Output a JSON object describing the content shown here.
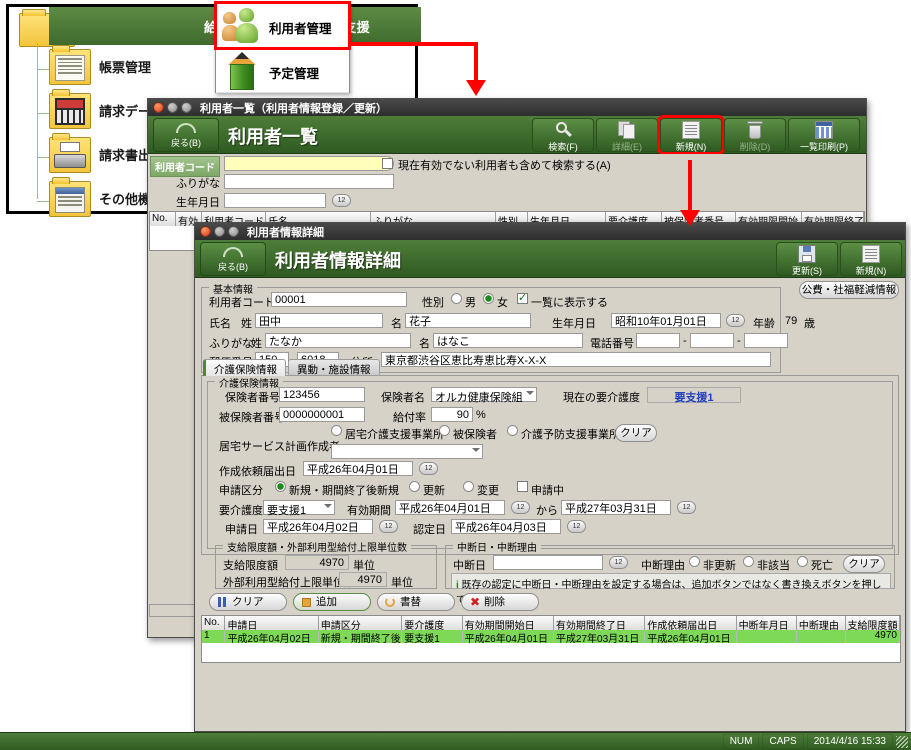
{
  "base_window": {
    "header_title": "給付管理/介護報酬請求支援",
    "tree_items": [
      {
        "label": "帳票管理",
        "icon": "document-folder-icon"
      },
      {
        "label": "請求データ作成",
        "icon": "calculator-folder-icon"
      },
      {
        "label": "請求書出力",
        "icon": "printer-folder-icon"
      },
      {
        "label": "その他機能",
        "icon": "list-folder-icon"
      }
    ]
  },
  "popup_menu": {
    "items": [
      {
        "label": "利用者管理",
        "icon": "people-icon",
        "highlighted": true
      },
      {
        "label": "予定管理",
        "icon": "pencil-icon",
        "highlighted": false
      }
    ]
  },
  "list_window": {
    "title": "利用者一覧（利用者情報登録／更新）",
    "bar_title": "利用者一覧",
    "back_label": "戻る(B)",
    "toolbar": [
      {
        "label": "検索(F)",
        "icon": "search-icon",
        "enabled": true,
        "highlighted": false
      },
      {
        "label": "詳細(E)",
        "icon": "documents-icon",
        "enabled": false,
        "highlighted": false
      },
      {
        "label": "新規(N)",
        "icon": "document-icon",
        "enabled": true,
        "highlighted": true
      },
      {
        "label": "削除(D)",
        "icon": "trash-icon",
        "enabled": false,
        "highlighted": false
      },
      {
        "label": "一覧印刷(P)",
        "icon": "grid-icon",
        "enabled": true,
        "highlighted": false
      }
    ],
    "search": {
      "code_label": "利用者コード",
      "code_value": "",
      "kana_label": "ふりがな",
      "kana_value": "",
      "birth_label": "生年月日",
      "birth_value": "",
      "calendar_icon": "12",
      "checkbox_label": "現在有効でない利用者も含めて検索する(A)",
      "checkbox_checked": false
    },
    "columns": [
      "No.",
      "有効",
      "利用者コード",
      "氏名",
      "ふりがな",
      "性別",
      "生年月日",
      "要介護度",
      "被保険者番号",
      "有効期限開始",
      "有効期限終了"
    ]
  },
  "detail_window": {
    "title": "利用者情報詳細",
    "bar_title": "利用者情報詳細",
    "back_label": "戻る(B)",
    "toolbar": [
      {
        "label": "更新(S)",
        "icon": "save-icon"
      },
      {
        "label": "新規(N)",
        "icon": "document-icon"
      }
    ],
    "koshi_button": "公費・社福軽減情報",
    "basic_info": {
      "caption": "基本情報",
      "code_label": "利用者コード",
      "code_value": "00001",
      "gender_label": "性別",
      "gender_male": "男",
      "gender_female": "女",
      "gender_selected": "女",
      "show_in_list_label": "一覧に表示する",
      "show_in_list_checked": true,
      "name_label": "氏名",
      "sei_label": "姓",
      "sei_value": "田中",
      "mei_label": "名",
      "mei_value": "花子",
      "birth_label": "生年月日",
      "birth_value": "昭和10年01月01日",
      "age_label": "年齢",
      "age_value": "79",
      "age_unit": "歳",
      "kana_label": "ふりがな",
      "kana_sei_value": "たなか",
      "kana_mei_value": "はなこ",
      "tel_label": "電話番号",
      "tel1": "",
      "tel2": "",
      "tel3": "",
      "zip_label": "郵便番号",
      "zip1": "150",
      "zip2": "6018",
      "address_label": "住所",
      "address_value": "東京都渋谷区恵比寿恵比寿X-X-X"
    },
    "tabs": [
      {
        "label": "介護保険情報",
        "active": true
      },
      {
        "label": "異動・施設情報",
        "active": false
      }
    ],
    "insurance": {
      "caption": "介護保険情報",
      "insurer_no_label": "保険者番号",
      "insurer_no_value": "123456",
      "insurer_name_label": "保険者名",
      "insurer_name_value": "オルカ健康保険組合",
      "current_care_label": "現在の要介護度",
      "current_care_value": "要支援1",
      "insured_no_label": "被保険者番号",
      "insured_no_value": "0000000001",
      "benefit_rate_label": "給付率",
      "benefit_rate_value": "90",
      "benefit_rate_unit": "%",
      "planner_label": "居宅サービス計画作成者",
      "planner_options": [
        "居宅介護支援事業所",
        "被保険者",
        "介護予防支援事業所"
      ],
      "planner_selected": "",
      "planner_clear": "クリア",
      "planner_combo_value": "",
      "request_date_label": "作成依頼届出日",
      "request_date_value": "平成26年04月01日",
      "appl_type_label": "申請区分",
      "appl_types": [
        "新規・期間終了後新規",
        "更新",
        "変更"
      ],
      "appl_type_selected": "新規・期間終了後新規",
      "applying_label": "申請中",
      "applying_checked": false,
      "care_level_label": "要介護度",
      "care_level_value": "要支援1",
      "valid_period_label": "有効期間",
      "valid_from": "平成26年04月01日",
      "kara_label": "から",
      "valid_to": "平成27年03月31日",
      "appl_date_label": "申請日",
      "appl_date_value": "平成26年04月02日",
      "approve_date_label": "認定日",
      "approve_date_value": "平成26年04月03日"
    },
    "limit_group": {
      "caption": "支給限度額・外部利用型給付上限単位数",
      "limit_label": "支給限度額",
      "limit_value": "4970",
      "limit_unit": "単位",
      "ext_label": "外部利用型給付上限単位数",
      "ext_value": "4970",
      "ext_unit": "単位"
    },
    "suspend_group": {
      "caption": "中断日・中断理由",
      "date_label": "中断日",
      "date_value": "",
      "reason_label": "中断理由",
      "reasons": [
        "非更新",
        "非該当",
        "死亡"
      ],
      "reason_selected": "",
      "clear_label": "クリア",
      "note": "既存の認定に中断日・中断理由を設定する場合は、追加ボタンではなく書き換えボタンを押してください。"
    },
    "action_buttons": [
      {
        "label": "クリア",
        "icon": "pause-icon"
      },
      {
        "label": "追加",
        "icon": "add-icon"
      },
      {
        "label": "書替",
        "icon": "rewrite-icon"
      },
      {
        "label": "削除",
        "icon": "delete-icon"
      }
    ],
    "table": {
      "columns": [
        "No.",
        "申請日",
        "申請区分",
        "要介護度",
        "有効期間開始日",
        "有効期間終了日",
        "作成依頼届出日",
        "中断年月日",
        "中断理由",
        "支給限度額"
      ],
      "rows": [
        [
          "1",
          "平成26年04月02日",
          "新規・期間終了後...",
          "要支援1",
          "平成26年04月01日",
          "平成27年03月31日",
          "平成26年04月01日",
          "",
          "",
          "4970"
        ]
      ]
    }
  },
  "status_bar": {
    "num": "NUM",
    "caps": "CAPS",
    "datetime": "2014/4/16 15:33"
  },
  "colors": {
    "green_bar": "#3f6a2d",
    "row_green": "#7ed957",
    "accent_red": "#ff0000",
    "yellow_field": "#ffffbb",
    "link_blue": "#1f3fbf"
  }
}
